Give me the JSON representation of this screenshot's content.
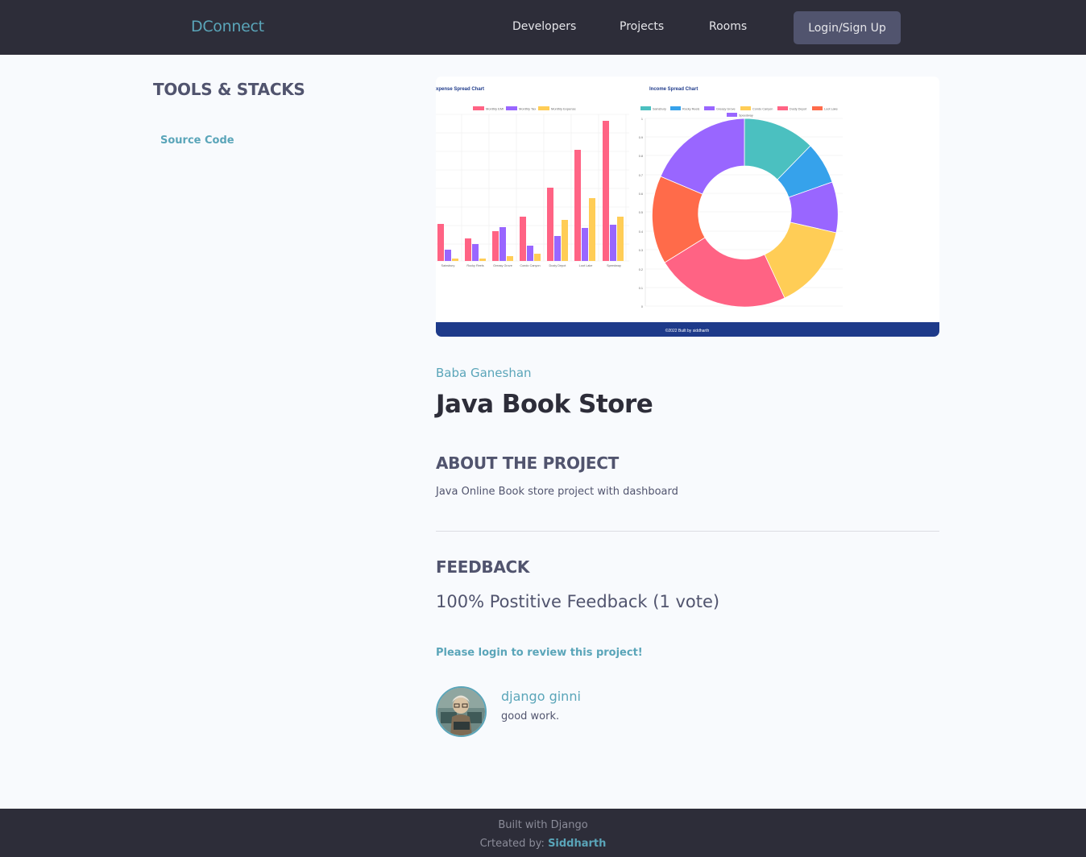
{
  "header": {
    "logo": "DConnect",
    "nav": {
      "developers": "Developers",
      "projects": "Projects",
      "rooms": "Rooms"
    },
    "login_button": "Login/Sign Up"
  },
  "sidebar": {
    "title": "TOOLS & STACKS",
    "source_link": "Source Code"
  },
  "project": {
    "owner": "Baba Ganeshan",
    "title": "Java Book Store",
    "about_heading": "ABOUT THE PROJECT",
    "about_text": "Java Online Book store project with dashboard",
    "feedback_heading": "FEEDBACK",
    "feedback_stat": "100% Postitive Feedback (1 vote)",
    "login_prompt": "Please login to review this project!"
  },
  "screenshot": {
    "left_chart_title": "xpense Spread Chart",
    "right_chart_title": "Income Spread Chart",
    "footer_text": "©2022 Built by siddharth",
    "bar_legend": [
      "Monthly EMI",
      "Monthly Tax",
      "Monthly Expense"
    ],
    "bar_categories": [
      "Sainsbury",
      "Rocky Reels",
      "Greasy Grove",
      "Condo Canyon",
      "Dusty Depot",
      "Loot Lake",
      "Speedway"
    ],
    "donut_legend": [
      "Sainsbury",
      "Rocky Reels",
      "Greasy Grove",
      "Condo Canyon",
      "Dusty Depot",
      "Loot Lake",
      "Speedway"
    ],
    "y_ticks": [
      "1",
      "0.9",
      "0.8",
      "0.7",
      "0.6",
      "0.5",
      "0.4",
      "0.3",
      "0.2",
      "0.1",
      "0"
    ],
    "colors": {
      "pink": "#ff6384",
      "purple": "#9966ff",
      "yellow": "#ffcd56",
      "teal": "#4bc0c0",
      "blue": "#36a2eb",
      "red": "#ff6b4a",
      "footer": "#1e3a8a"
    }
  },
  "review": {
    "author": "django ginni",
    "body": "good work."
  },
  "footer": {
    "built_with": "Built with Django",
    "created_by": "Crteated by: ",
    "author": "Siddharth"
  }
}
